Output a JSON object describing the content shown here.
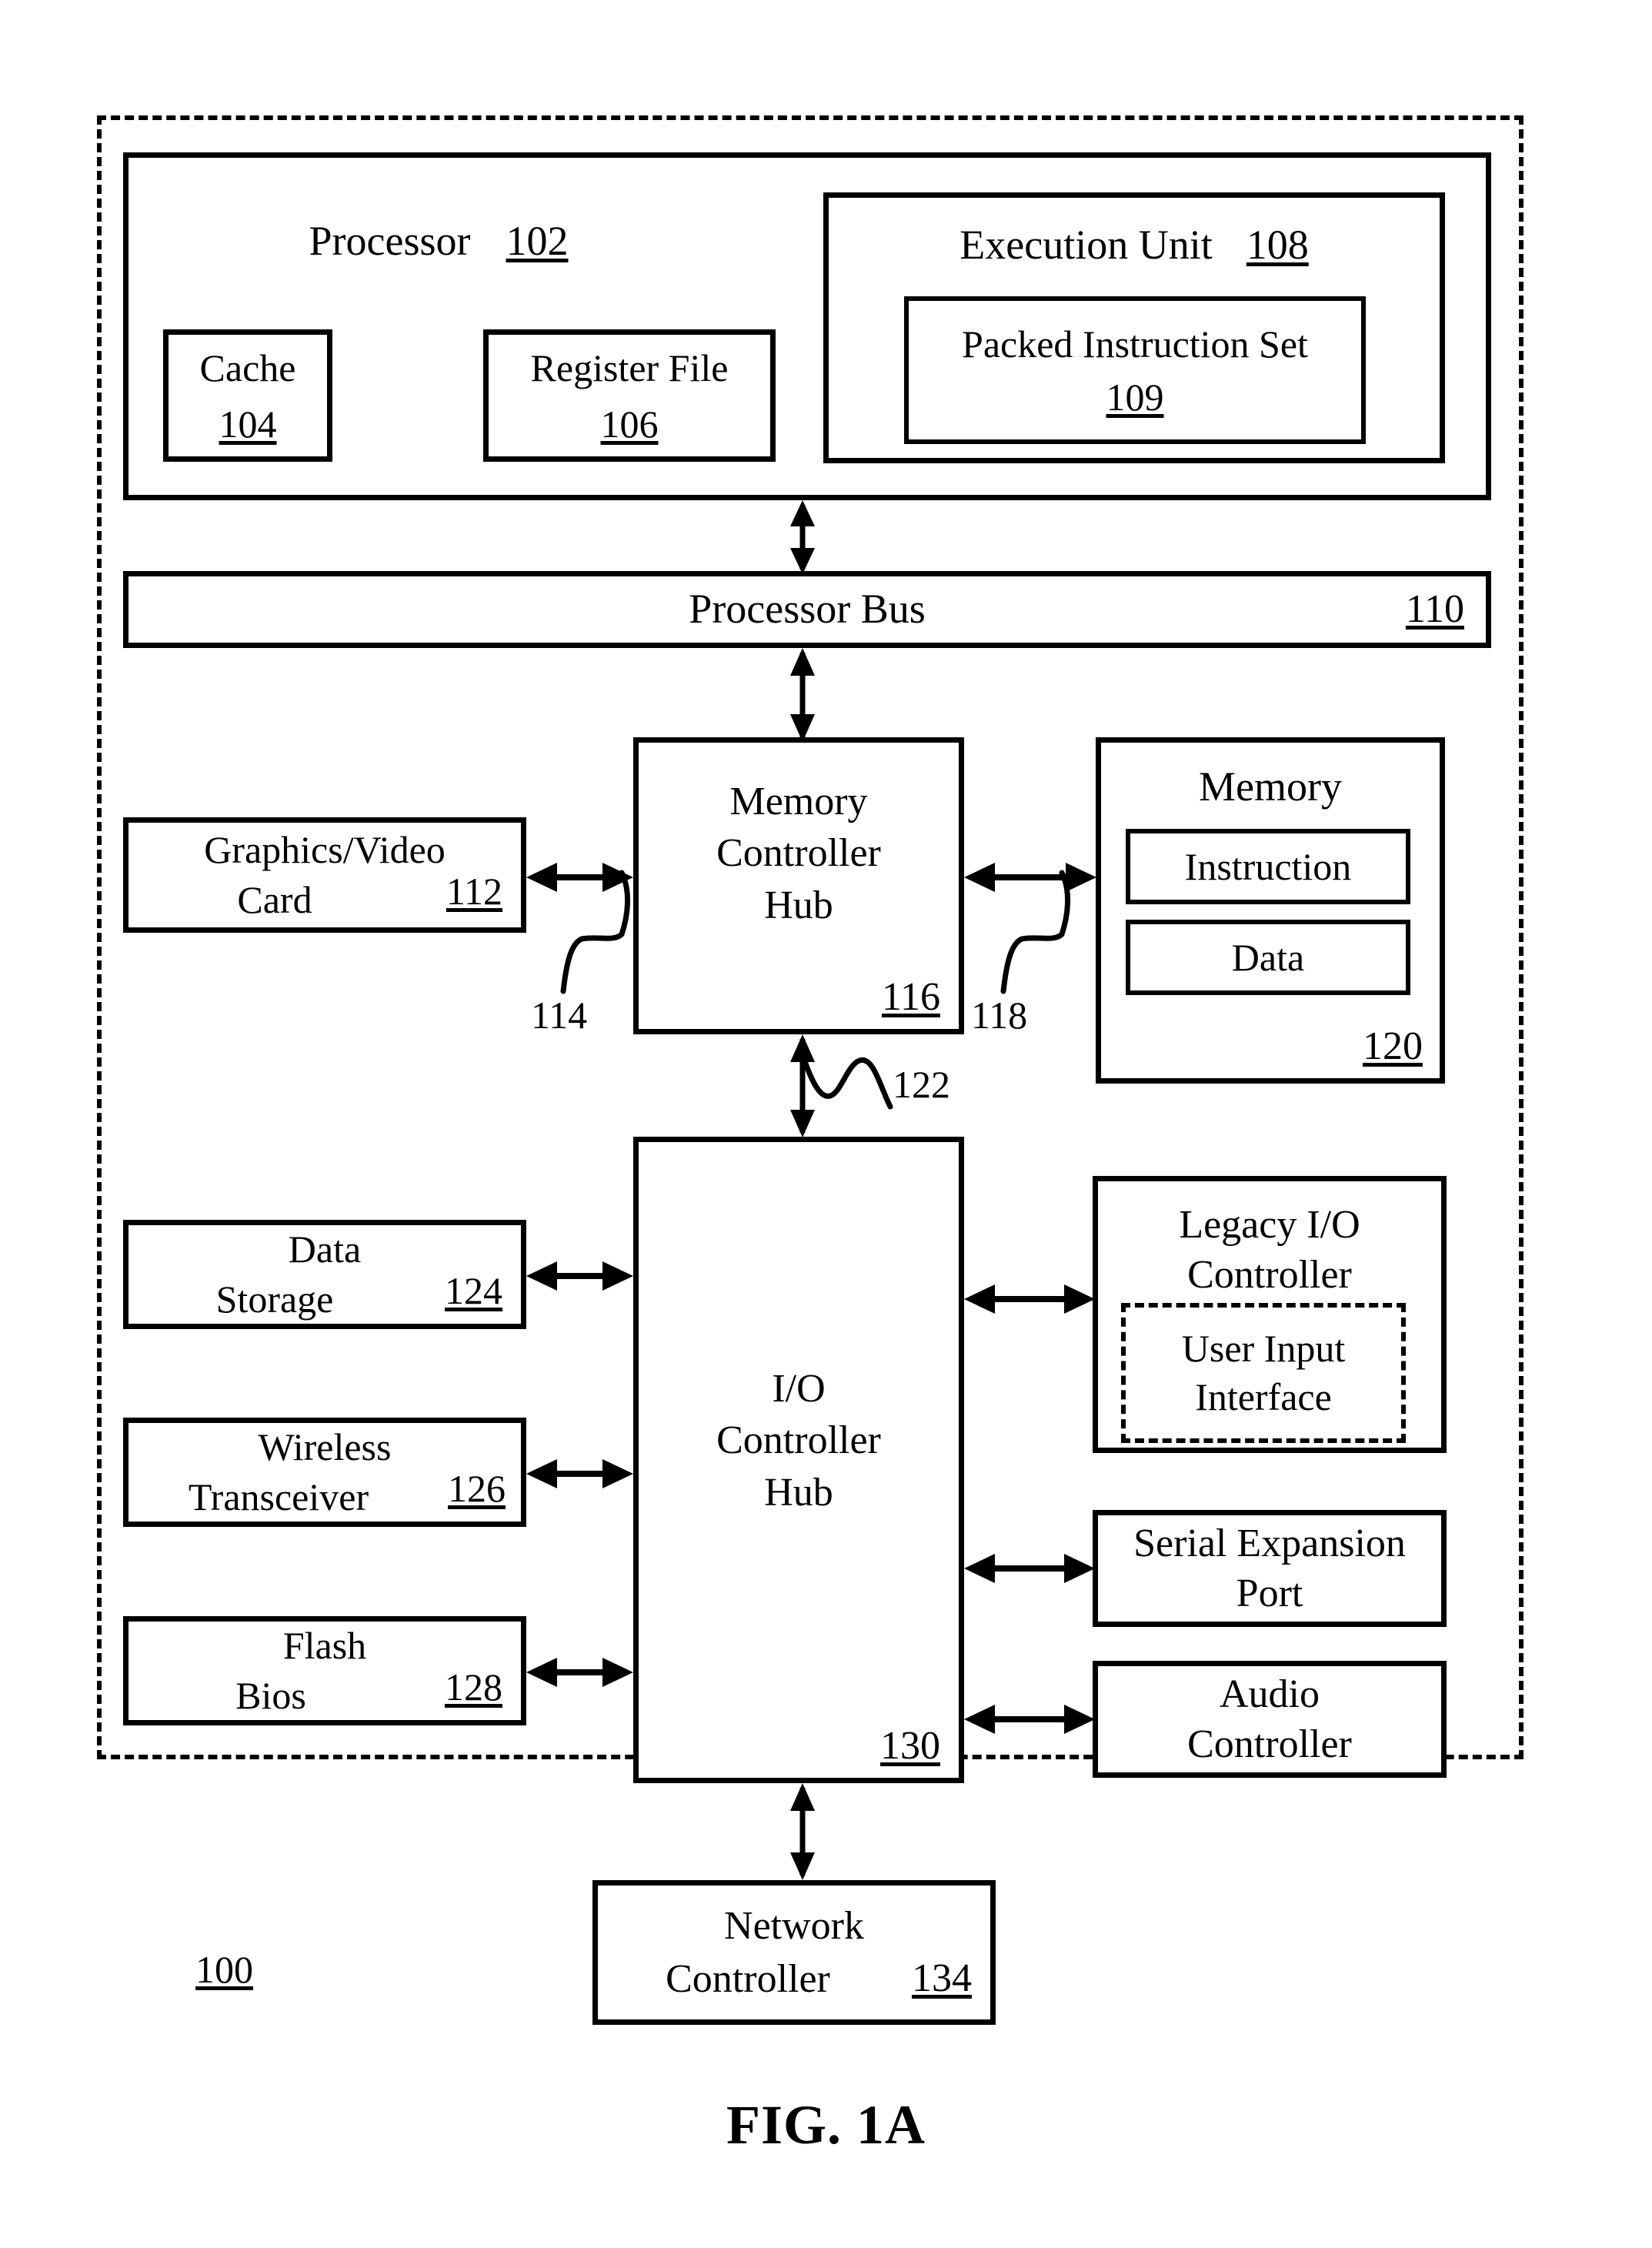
{
  "figure": {
    "caption": "FIG. 1A",
    "system_ref": "100"
  },
  "processor": {
    "title": "Processor",
    "ref": "102",
    "cache": {
      "title": "Cache",
      "ref": "104"
    },
    "register_file": {
      "title": "Register File",
      "ref": "106"
    },
    "execution_unit": {
      "title": "Execution Unit",
      "ref": "108",
      "packed_instruction_set": {
        "title": "Packed Instruction Set",
        "ref": "109"
      }
    }
  },
  "processor_bus": {
    "title": "Processor Bus",
    "ref": "110"
  },
  "graphics_video_card": {
    "line1": "Graphics/Video",
    "line2": "Card",
    "ref": "112"
  },
  "memory_controller_hub": {
    "line1": "Memory",
    "line2": "Controller",
    "line3": "Hub",
    "ref": "116"
  },
  "memory": {
    "title": "Memory",
    "ref": "120",
    "instruction": "Instruction",
    "data": "Data"
  },
  "io_controller_hub": {
    "line1": "I/O",
    "line2": "Controller",
    "line3": "Hub",
    "ref": "130"
  },
  "data_storage": {
    "line1": "Data",
    "line2": "Storage",
    "ref": "124"
  },
  "wireless_transceiver": {
    "line1": "Wireless",
    "line2": "Transceiver",
    "ref": "126"
  },
  "flash_bios": {
    "line1": "Flash",
    "line2": "Bios",
    "ref": "128"
  },
  "legacy_io_controller": {
    "line1": "Legacy I/O",
    "line2": "Controller",
    "user_input_interface": {
      "line1": "User Input",
      "line2": "Interface"
    }
  },
  "serial_expansion_port": {
    "line1": "Serial Expansion",
    "line2": "Port"
  },
  "audio_controller": {
    "line1": "Audio",
    "line2": "Controller"
  },
  "network_controller": {
    "line1": "Network",
    "line2": "Controller",
    "ref": "134"
  },
  "bus_refs": {
    "graphics_link": "114",
    "memory_link": "118",
    "hub_interface": "122"
  },
  "colors": {
    "ink": "#000000",
    "paper": "#ffffff"
  }
}
